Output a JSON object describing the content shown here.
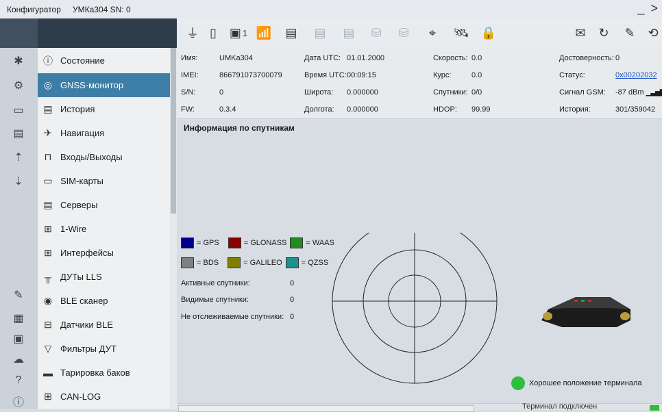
{
  "titlebar": {
    "app": "Конфигуратор",
    "device": "УМКа304 SN: 0"
  },
  "toolbar": {
    "icons": [
      "usb-plug-icon",
      "battery-icon",
      "sim-card-icon",
      "wifi-home-icon",
      "server-connected-icon",
      "server-download-icon",
      "server-upload-icon",
      "database-refresh-icon",
      "database-settings-icon",
      "location-off-icon",
      "satellite-icon",
      "lock-alert-icon",
      "envelope-icon",
      "document-refresh-icon",
      "clean-icon",
      "update-icon"
    ],
    "sim_number": "1"
  },
  "menu": {
    "items": [
      {
        "label": "Состояние",
        "icon": "info-icon"
      },
      {
        "label": "GNSS-монитор",
        "icon": "gnss-icon"
      },
      {
        "label": "История",
        "icon": "book-icon"
      },
      {
        "label": "Навигация",
        "icon": "satellite-icon"
      },
      {
        "label": "Входы/Выходы",
        "icon": "io-icon"
      },
      {
        "label": "SIM-карты",
        "icon": "sim-icon"
      },
      {
        "label": "Серверы",
        "icon": "server-icon"
      },
      {
        "label": "1-Wire",
        "icon": "connector-icon"
      },
      {
        "label": "Интерфейсы",
        "icon": "connector-icon"
      },
      {
        "label": "ДУТы LLS",
        "icon": "sensor-icon"
      },
      {
        "label": "BLE сканер",
        "icon": "bluetooth-icon"
      },
      {
        "label": "Датчики BLE",
        "icon": "ble-sensor-icon"
      },
      {
        "label": "Фильтры ДУТ",
        "icon": "filter-icon"
      },
      {
        "label": "Тарировка баков",
        "icon": "tank-icon"
      },
      {
        "label": "CAN-LOG",
        "icon": "connector-icon"
      }
    ]
  },
  "info": {
    "name_label": "Имя:",
    "name_value": "UMKa304",
    "imei_label": "IMEI:",
    "imei_value": "866791073700079",
    "sn_label": "S/N:",
    "sn_value": "0",
    "fw_label": "FW:",
    "fw_value": "0.3.4",
    "date_label": "Дата UTC:",
    "date_value": "01.01.2000",
    "time_label": "Время UTC:",
    "time_value": "00:09:15",
    "lat_label": "Широта:",
    "lat_value": "0.000000",
    "lon_label": "Долгота:",
    "lon_value": "0.000000",
    "speed_label": "Скорость:",
    "speed_value": "0.0",
    "course_label": "Курс:",
    "course_value": "0.0",
    "sats_label": "Спутники:",
    "sats_value": "0/0",
    "hdop_label": "HDOP:",
    "hdop_value": "99.99",
    "valid_label": "Достоверность:",
    "valid_value": "0",
    "status_label": "Статус:",
    "status_value": "0x00202032",
    "gsm_label": "Сигнал GSM:",
    "gsm_value": "-87 dBm",
    "history_label": "История:",
    "history_value": "301/359042"
  },
  "satellites": {
    "title": "Информация по спутникам",
    "legend": [
      {
        "label": "= GPS",
        "color": "#00008b"
      },
      {
        "label": "= GLONASS",
        "color": "#8b0000"
      },
      {
        "label": "= WAAS",
        "color": "#228b22"
      },
      {
        "label": "= BDS",
        "color": "#808080"
      },
      {
        "label": "= GALILEO",
        "color": "#808000"
      },
      {
        "label": "= QZSS",
        "color": "#1f8f8f"
      }
    ],
    "active_label": "Активные спутники:",
    "active_value": "0",
    "visible_label": "Видимые спутники:",
    "visible_value": "0",
    "untracked_label": "Не отслеживаемые спутники:",
    "untracked_value": "0"
  },
  "terminal_position": "Хорошее положение терминала",
  "statusbar": {
    "text": "Терминал подключен"
  }
}
